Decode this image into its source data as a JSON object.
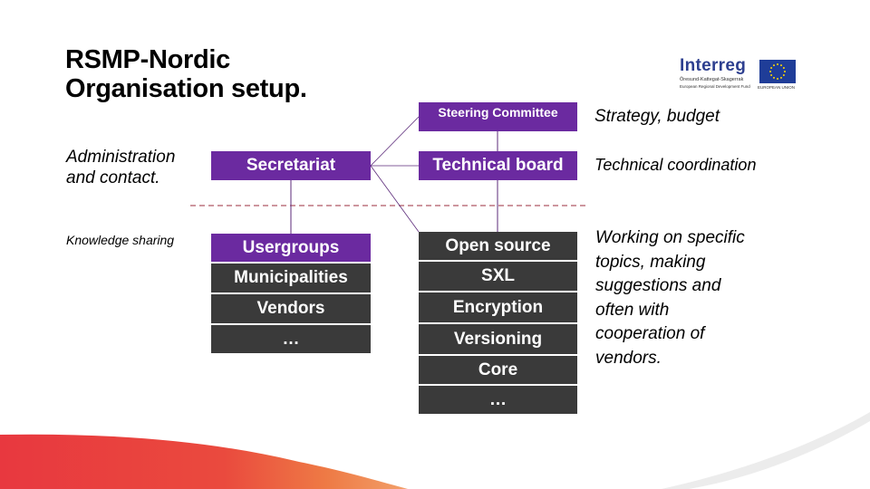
{
  "slide": {
    "title_line1": "RSMP-Nordic",
    "title_line2": "Organisation setup."
  },
  "left_labels": {
    "admin_line1": "Administration",
    "admin_line2": "and contact.",
    "knowledge": "Knowledge sharing"
  },
  "org": {
    "secretariat": "Secretariat",
    "steering_committee": "Steering Committee",
    "technical_board": "Technical board",
    "usergroups": {
      "header": "Usergroups",
      "items": [
        "Municipalities",
        "Vendors",
        "…"
      ]
    },
    "open_source": {
      "header": "Open source",
      "items": [
        "SXL",
        "Encryption",
        "Versioning",
        "Core",
        "…"
      ]
    }
  },
  "descriptions": {
    "steering": "Strategy, budget",
    "technical": "Technical coordination",
    "working_lines": [
      "Working on specific",
      "topics, making",
      "suggestions and",
      "often with",
      "cooperation of",
      "vendors."
    ]
  },
  "logo": {
    "wordmark": "Interreg",
    "subtitle": "Öresund-Kattegat-Skagerrak",
    "fund": "European Regional Development Fund",
    "eu_caption": "EUROPEAN UNION"
  },
  "colors": {
    "purple": "#6b2aa0",
    "dark": "#3a3a3a",
    "connector": "#5b2a7a",
    "divider": "#9b2c3c",
    "swoosh_red": "#e8383f",
    "swoosh_orange": "#ee7a45",
    "interreg_blue": "#2d3f8f",
    "eu_blue": "#1f3d98",
    "eu_star": "#ffd700"
  }
}
